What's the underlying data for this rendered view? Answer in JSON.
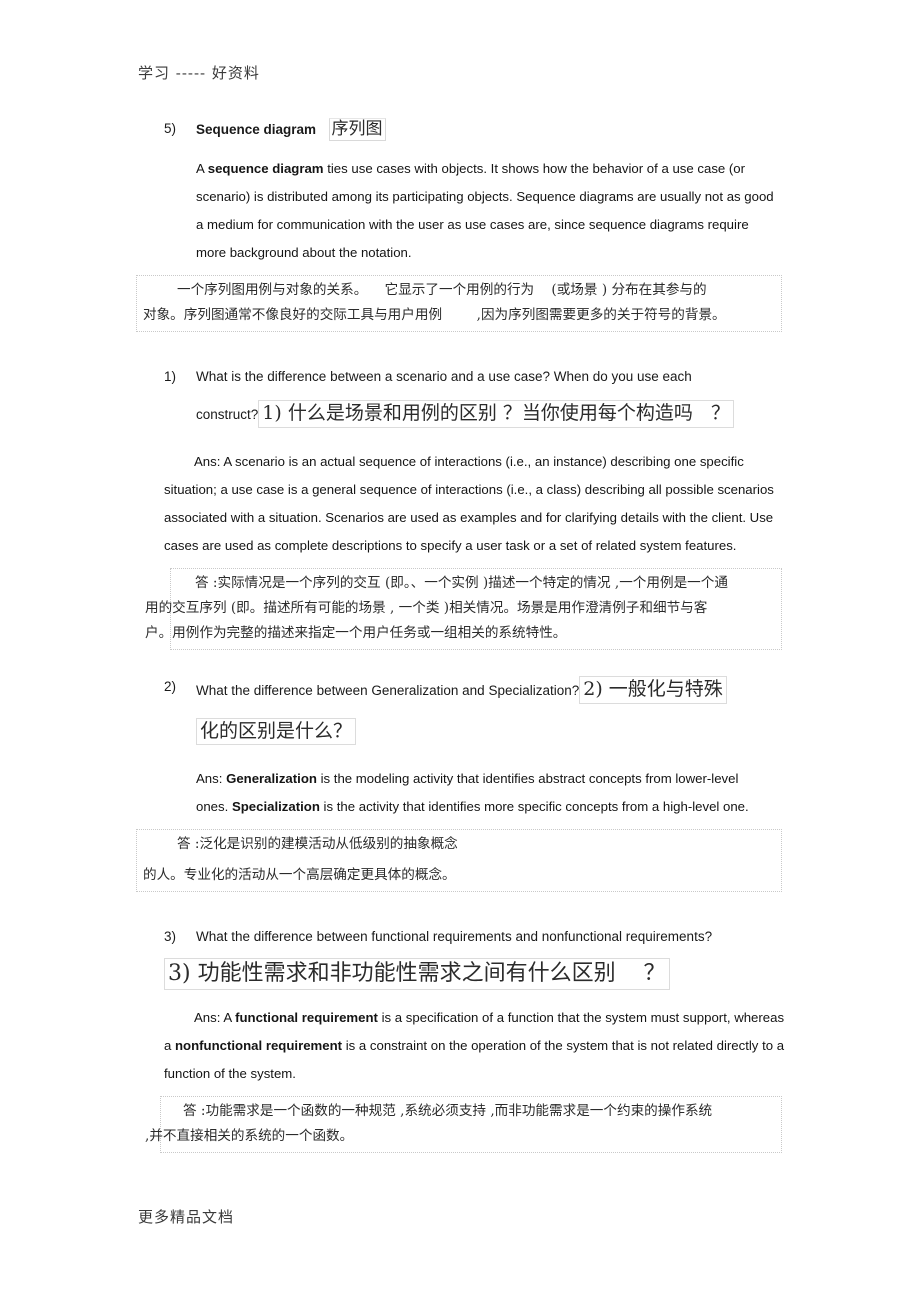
{
  "header": {
    "running_head": "学习 ----- 好资料"
  },
  "footer": {
    "running_foot": "更多精品文档"
  },
  "sections": {
    "sequence_diagram": {
      "marker": "5)",
      "title_en": "Sequence diagram",
      "title_cn": "序列图",
      "body_en_line1_lead": "A ",
      "body_en_bold": "sequence diagram",
      "body_en_rest": " ties use cases with objects. It shows how the behavior of a use case (or scenario) is distributed among its participating objects. Sequence diagrams are usually not as good a medium for communication with the user as use cases are, since sequence diagrams require more background about the notation.",
      "body_cn_line1": "一个序列图用例与对象的关系。    它显示了一个用例的行为    (或场景 ) 分布在其参与的",
      "body_cn_line2": "对象。序列图通常不像良好的交际工具与用户用例        ,因为序列图需要更多的关于符号的背景。"
    },
    "q1": {
      "marker": "1)",
      "question_en_line1": "What  is the difference  between a scenario and a use case? When do you use each",
      "question_en_line2": "construct?",
      "question_cn": "1) 什么是场景和用例的区别 ？当你使用每个构造吗   ？",
      "answer_en": "Ans: A scenario is an actual sequence of interactions (i.e., an instance) describing one specific situation; a use case is a general sequence of interactions (i.e., a class) describing all possible scenarios associated with a situation. Scenarios are used as examples and for clarifying details with the client. Use cases are used as complete descriptions to specify a user task or a set of related system features.",
      "answer_cn_line1": "答 :实际情况是一个序列的交互 (即。、一个实例 )描述一个特定的情况 ,一个用例是一个通",
      "answer_cn_line2": "用的交互序列 (即。描述所有可能的场景 , 一个类 )相关情况。场景是用作澄清例子和细节与客",
      "answer_cn_line3": "户。用例作为完整的描述来指定一个用户任务或一组相关的系统特性。"
    },
    "q2": {
      "marker": "2)",
      "question_en": "What the difference  between Generalization  and Specialization?",
      "question_cn_line1": "2) 一般化与特殊",
      "question_cn_line2": "化的区别是什么？",
      "answer_en_lead": "Ans: ",
      "answer_en_bold1": "Generalization",
      "answer_en_mid1": " is   the   modeling   activity   that  identifies   abstract  concepts  from lower-level",
      "answer_en_line2_pre": "ones. ",
      "answer_en_bold2": "Specialization",
      "answer_en_mid2": " is the activity    that identifies  more specific  concepts from a high-level one.",
      "answer_cn_line1": "答 :泛化是识别的建模活动从低级别的抽象概念",
      "answer_cn_line2": "的人。专业化的活动从一个高层确定更具体的概念。"
    },
    "q3": {
      "marker": "3)",
      "question_en": "What the difference between functional requirements and nonfunctional requirements?",
      "question_cn": "3) 功能性需求和非功能性需求之间有什么区别    ？",
      "answer_en_lead": "Ans: A ",
      "answer_en_bold1": "functional requirement",
      "answer_en_mid1": " is a specification of a function that the system must support, whereas a ",
      "answer_en_bold2": "nonfunctional requirement",
      "answer_en_mid2": " is a constraint on the operation of the system that is not related directly to a function of the system.",
      "answer_cn_line1": "答 :功能需求是一个函数的一种规范 ,系统必须支持 ,而非功能需求是一个约束的操作系统",
      "answer_cn_line2": ",并不直接相关的系统的一个函数。"
    }
  }
}
